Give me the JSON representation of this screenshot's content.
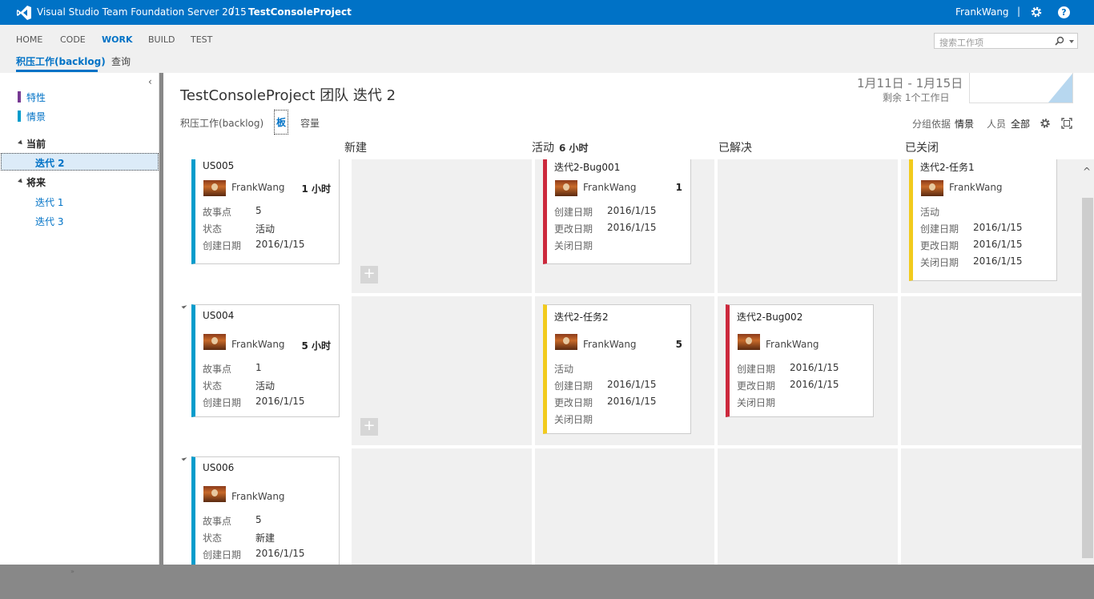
{
  "header": {
    "product": "Visual Studio Team Foundation Server 2015",
    "separator": "/",
    "project": "TestConsoleProject",
    "user": "FrankWang",
    "pipe": "|",
    "help": "?"
  },
  "nav": {
    "items": [
      "HOME",
      "CODE",
      "WORK",
      "BUILD",
      "TEST"
    ],
    "active": "WORK",
    "search_placeholder": "搜索工作项",
    "subtabs": [
      "积压工作(backlog)",
      "查询"
    ]
  },
  "sidebar": {
    "collapse": "‹",
    "backlogs": [
      {
        "label": "特性",
        "color": "#773b93"
      },
      {
        "label": "情景",
        "color": "#009ccc"
      }
    ],
    "current_head": "当前",
    "current_items": [
      "迭代 2"
    ],
    "future_head": "将来",
    "future_items": [
      "迭代 1",
      "迭代 3"
    ],
    "resize": "»"
  },
  "main": {
    "title": "TestConsoleProject 团队 迭代 2",
    "date_range": "1月11日 - 1月15日",
    "remaining": "剩余 1个工作日",
    "views": [
      "积压工作(backlog)",
      "板",
      "容量"
    ],
    "groupby_label": "分组依据",
    "groupby_value": "情景",
    "people_label": "人员",
    "people_value": "全部",
    "columns": [
      {
        "name": "新建",
        "count": ""
      },
      {
        "name": "活动",
        "count": "6 小时"
      },
      {
        "name": "已解决",
        "count": ""
      },
      {
        "name": "已关闭",
        "count": ""
      }
    ],
    "plus": "+",
    "scroll_up": "^"
  },
  "cards": {
    "us005": {
      "title": "US005",
      "owner": "FrankWang",
      "remaining": "1 小时",
      "f1l": "故事点",
      "f1v": "5",
      "f2l": "状态",
      "f2v": "活动",
      "f3l": "创建日期",
      "f3v": "2016/1/15"
    },
    "us004": {
      "title": "US004",
      "owner": "FrankWang",
      "remaining": "5 小时",
      "f1l": "故事点",
      "f1v": "1",
      "f2l": "状态",
      "f2v": "活动",
      "f3l": "创建日期",
      "f3v": "2016/1/15"
    },
    "us006": {
      "title": "US006",
      "owner": "FrankWang",
      "remaining": "",
      "f1l": "故事点",
      "f1v": "5",
      "f2l": "状态",
      "f2v": "新建",
      "f3l": "创建日期",
      "f3v": "2016/1/15"
    },
    "bug001": {
      "title": "迭代2-Bug001",
      "owner": "FrankWang",
      "remaining": "1",
      "f1l": "创建日期",
      "f1v": "2016/1/15",
      "f2l": "更改日期",
      "f2v": "2016/1/15",
      "f3l": "关闭日期",
      "f3v": ""
    },
    "task2": {
      "title": "迭代2-任务2",
      "owner": "FrankWang",
      "remaining": "5",
      "state": "活动",
      "f1l": "创建日期",
      "f1v": "2016/1/15",
      "f2l": "更改日期",
      "f2v": "2016/1/15",
      "f3l": "关闭日期",
      "f3v": ""
    },
    "bug002": {
      "title": "迭代2-Bug002",
      "owner": "FrankWang",
      "f1l": "创建日期",
      "f1v": "2016/1/15",
      "f2l": "更改日期",
      "f2v": "2016/1/15",
      "f3l": "关闭日期",
      "f3v": ""
    },
    "task1": {
      "title": "迭代2-任务1",
      "owner": "FrankWang",
      "state": "活动",
      "f1l": "创建日期",
      "f1v": "2016/1/15",
      "f2l": "更改日期",
      "f2v": "2016/1/15",
      "f3l": "关闭日期",
      "f3v": "2016/1/15"
    }
  }
}
